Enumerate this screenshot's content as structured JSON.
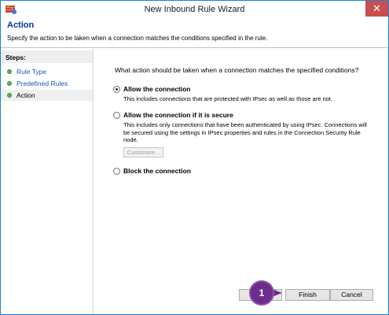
{
  "window": {
    "title": "New Inbound Rule Wizard",
    "close_glyph": "✕"
  },
  "header": {
    "title": "Action",
    "description": "Specify the action to be taken when a connection matches the conditions specified in the rule."
  },
  "steps": {
    "heading": "Steps:",
    "items": [
      {
        "label": "Rule Type"
      },
      {
        "label": "Predefined Rules"
      },
      {
        "label": "Action"
      }
    ]
  },
  "main": {
    "question": "What action should be taken when a connection matches the specified conditions?",
    "options": [
      {
        "label": "Allow the connection",
        "description": "This includes connections that are protected with IPsec as well as those are not.",
        "selected": true
      },
      {
        "label": "Allow the connection if it is secure",
        "description": "This includes only connections that have been authenticated by using IPsec.  Connections will be secured using the settings in IPsec properties and rules in the Connection Security Rule node.",
        "selected": false
      },
      {
        "label": "Block the connection",
        "description": "",
        "selected": false
      }
    ],
    "customize_label": "Customize..."
  },
  "buttons": {
    "back": "",
    "finish": "Finish",
    "cancel": "Cancel"
  },
  "annotation": {
    "callout_number": "1"
  },
  "colors": {
    "accent": "#003399",
    "step_dot": "#5ab54a",
    "close": "#c7504c",
    "callout": "#6f2c8f"
  }
}
